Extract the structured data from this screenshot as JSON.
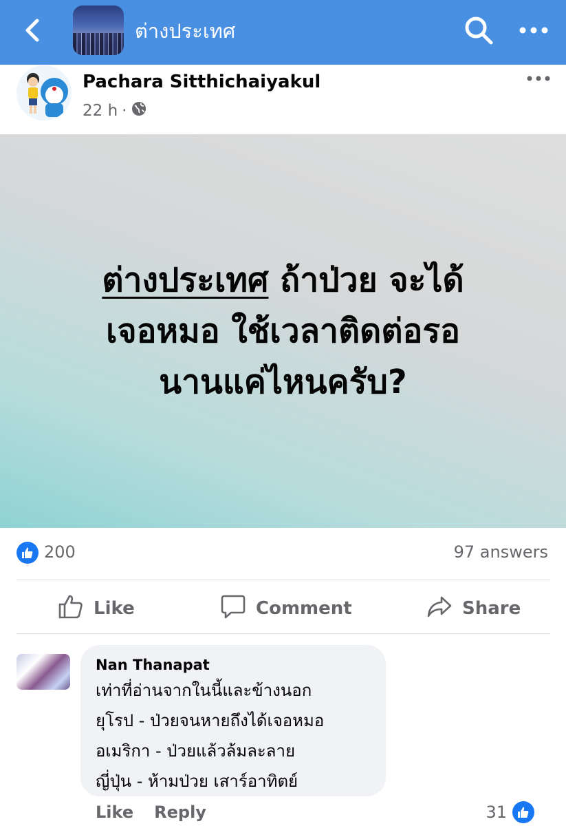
{
  "header": {
    "group_name": "ต่างประเทศ"
  },
  "post": {
    "author": "Pachara Sitthichaiyakul",
    "time": "22 h",
    "dot": "·",
    "text_underlined": "ต่างประเทศ",
    "text_line1_rest": " ถ้าป่วย จะได้",
    "text_line2": "เจอหมอ ใช้เวลาติดต่อรอ",
    "text_line3": "นานแค่ไหนครับ?",
    "reaction_count": "200",
    "answers": "97 answers"
  },
  "actions": {
    "like": "Like",
    "comment": "Comment",
    "share": "Share"
  },
  "comment": {
    "name": "Nan Thanapat",
    "lines": [
      "เท่าที่อ่านจากในนี้และข้างนอก",
      "ยุโรป - ป่วยจนหายถึงได้เจอหมอ",
      "อเมริกา - ป่วยแล้วล้มละลาย",
      "ญี่ปุ่น - ห้ามป่วย เสาร์อาทิตย์"
    ],
    "like_label": "Like",
    "reply_label": "Reply",
    "reaction_count": "31"
  },
  "colors": {
    "header_bg": "#4a90e2",
    "like_blue": "#1877f2",
    "meta_gray": "#65676b"
  }
}
